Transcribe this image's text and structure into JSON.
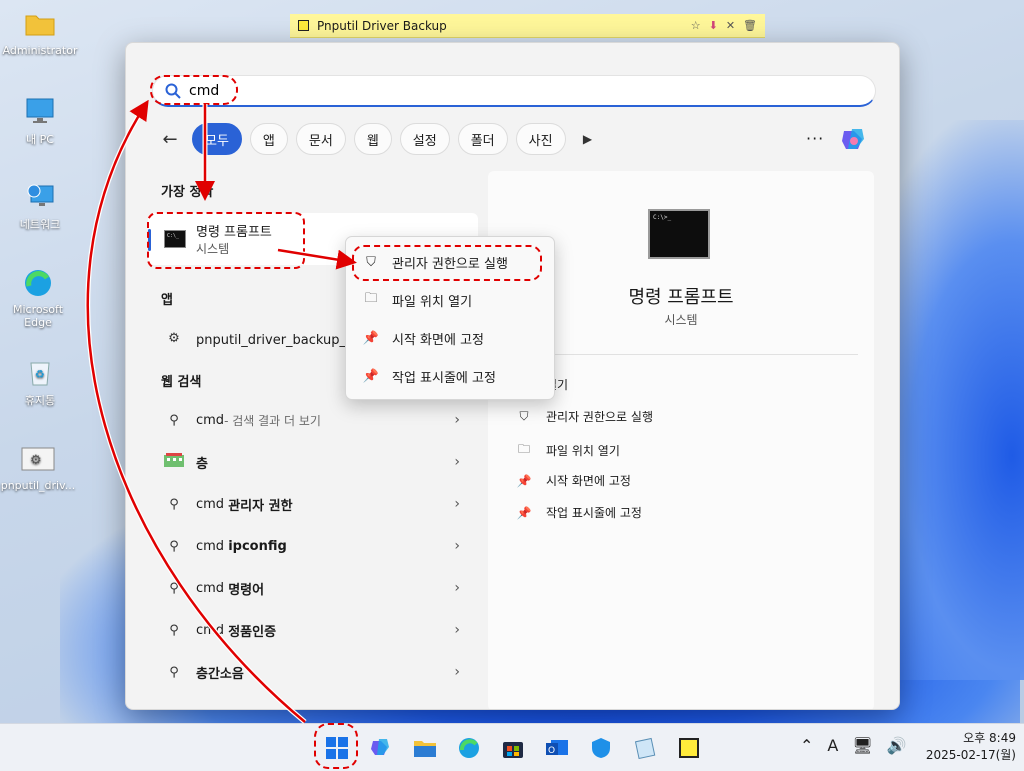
{
  "desktop": {
    "icons": [
      {
        "label": "Administrator",
        "icon": "folder-icon"
      },
      {
        "label": "내 PC",
        "icon": "monitor-icon"
      },
      {
        "label": "네트워크",
        "icon": "network-icon"
      },
      {
        "label": "Microsoft Edge",
        "icon": "edge-icon"
      },
      {
        "label": "휴지통",
        "icon": "recycle-bin-icon"
      },
      {
        "label": "pnputil_driv...",
        "icon": "gear-file-icon"
      }
    ]
  },
  "sticky_note": {
    "title": "Pnputil Driver Backup",
    "accent": "#fff79a"
  },
  "start_menu": {
    "search": {
      "value": "cmd",
      "placeholder": ""
    },
    "filters": [
      "모두",
      "앱",
      "문서",
      "웹",
      "설정",
      "폴더",
      "사진"
    ],
    "more_label": "···",
    "best_match": {
      "section": "가장 정확",
      "title": "명령 프롬프트",
      "subtitle": "시스템"
    },
    "apps": {
      "section": "앱",
      "items": [
        {
          "label": "pnputil_driver_backup_수"
        }
      ]
    },
    "web": {
      "section": "웹 검색",
      "items": [
        {
          "prefix": "cmd",
          "bold": "",
          "suffix": " - 검색 결과 더 보기"
        },
        {
          "prefix": "",
          "bold": "층",
          "suffix": ""
        },
        {
          "prefix": "cmd ",
          "bold": "관리자 권한",
          "suffix": ""
        },
        {
          "prefix": "cmd ",
          "bold": "ipconfig",
          "suffix": ""
        },
        {
          "prefix": "cmd ",
          "bold": "명령어",
          "suffix": ""
        },
        {
          "prefix": "cmd ",
          "bold": "정품인증",
          "suffix": ""
        },
        {
          "prefix": "",
          "bold": "층간소음",
          "suffix": ""
        }
      ]
    },
    "detail": {
      "title": "명령 프롬프트",
      "subtitle": "시스템",
      "actions": [
        {
          "label": "열기",
          "icon": "open-icon"
        },
        {
          "label": "관리자 권한으로 실행",
          "icon": "shield-icon"
        },
        {
          "label": "파일 위치 열기",
          "icon": "folder-open-icon"
        },
        {
          "label": "시작 화면에 고정",
          "icon": "pin-icon"
        },
        {
          "label": "작업 표시줄에 고정",
          "icon": "pin-icon"
        }
      ]
    },
    "accent": "#2a62d6"
  },
  "context_menu": {
    "items": [
      {
        "label": "관리자 권한으로 실행",
        "icon": "shield-icon"
      },
      {
        "label": "파일 위치 열기",
        "icon": "folder-open-icon"
      },
      {
        "label": "시작 화면에 고정",
        "icon": "pin-icon"
      },
      {
        "label": "작업 표시줄에 고정",
        "icon": "pin-icon"
      }
    ]
  },
  "taskbar": {
    "icons": [
      "windows-start-icon",
      "copilot-icon",
      "file-explorer-icon",
      "edge-icon",
      "store-icon",
      "outlook-icon",
      "defender-icon",
      "notepad-icon",
      "sticky-notes-icon"
    ],
    "ime": "A",
    "time": "오후 8:49",
    "date": "2025-02-17(월)"
  },
  "annotation_color": "#e00000"
}
